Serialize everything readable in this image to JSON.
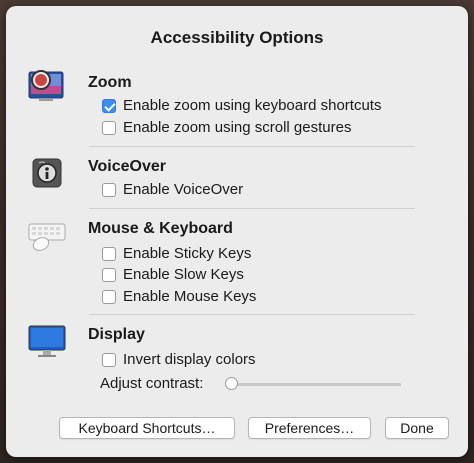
{
  "dialog": {
    "title": "Accessibility Options"
  },
  "zoom": {
    "title": "Zoom",
    "icon": "zoom-icon",
    "options": [
      {
        "label": "Enable zoom using keyboard shortcuts",
        "checked": true
      },
      {
        "label": "Enable zoom using scroll gestures",
        "checked": false
      }
    ]
  },
  "voiceover": {
    "title": "VoiceOver",
    "icon": "voiceover-icon",
    "options": [
      {
        "label": "Enable VoiceOver",
        "checked": false
      }
    ]
  },
  "mouse_keyboard": {
    "title": "Mouse & Keyboard",
    "icon": "keyboard-mouse-icon",
    "options": [
      {
        "label": "Enable Sticky Keys",
        "checked": false
      },
      {
        "label": "Enable Slow Keys",
        "checked": false
      },
      {
        "label": "Enable Mouse Keys",
        "checked": false
      }
    ]
  },
  "display": {
    "title": "Display",
    "icon": "display-icon",
    "options": [
      {
        "label": "Invert display colors",
        "checked": false
      }
    ],
    "contrast_label": "Adjust contrast:",
    "contrast_value": 0
  },
  "buttons": {
    "keyboard_shortcuts": "Keyboard Shortcuts…",
    "preferences": "Preferences…",
    "done": "Done"
  },
  "colors": {
    "accent": "#3b8ef0",
    "dialog_bg": "#ececec"
  }
}
